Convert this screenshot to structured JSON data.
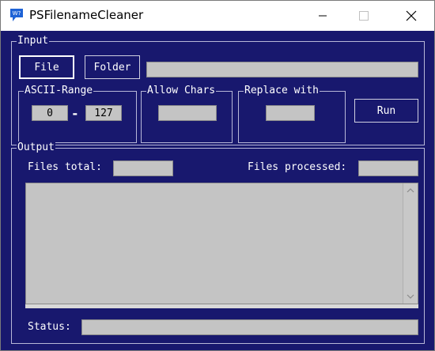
{
  "window": {
    "title": "PSFilenameCleaner"
  },
  "input_group": {
    "label": "Input",
    "file_button": "File",
    "folder_button": "Folder",
    "path_value": "",
    "ascii_range": {
      "label": "ASCII-Range",
      "min": "0",
      "separator": "-",
      "max": "127"
    },
    "allow_chars": {
      "label": "Allow Chars",
      "value": ""
    },
    "replace_with": {
      "label": "Replace with",
      "value": ""
    },
    "run_button": "Run"
  },
  "output_group": {
    "label": "Output",
    "files_total_label": "Files total:",
    "files_total_value": "",
    "files_processed_label": "Files processed:",
    "files_processed_value": "",
    "status_label": "Status:",
    "status_value": ""
  },
  "colors": {
    "background": "#18186e",
    "field": "#c4c4c4",
    "text": "#ffffff"
  }
}
